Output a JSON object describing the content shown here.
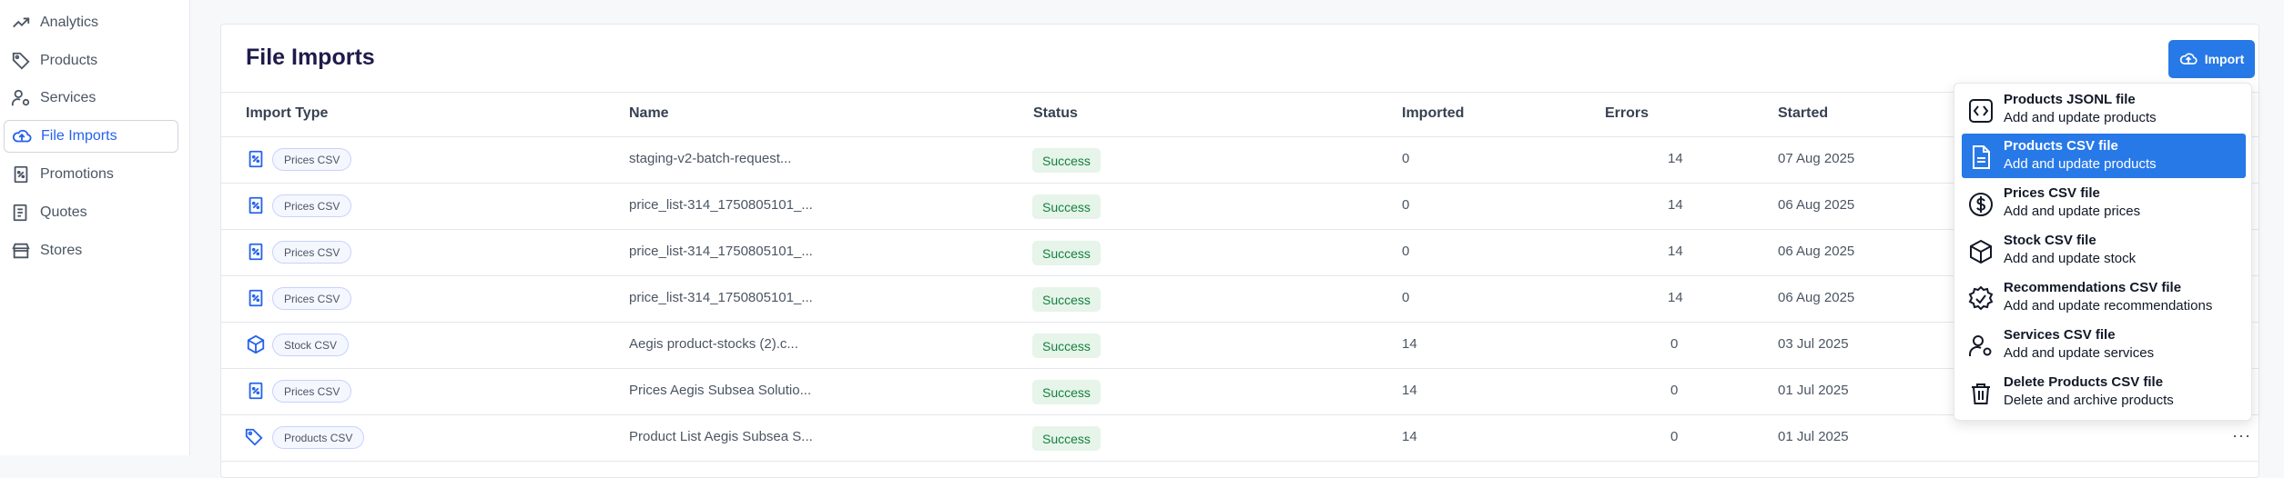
{
  "sidebar": {
    "items": [
      {
        "label": "Analytics",
        "icon": "trending-up-icon"
      },
      {
        "label": "Products",
        "icon": "tag-icon"
      },
      {
        "label": "Services",
        "icon": "user-cog-icon"
      },
      {
        "label": "File Imports",
        "icon": "cloud-upload-icon",
        "active": true
      },
      {
        "label": "Promotions",
        "icon": "percent-receipt-icon"
      },
      {
        "label": "Quotes",
        "icon": "document-list-icon"
      },
      {
        "label": "Stores",
        "icon": "store-icon"
      }
    ]
  },
  "page": {
    "title": "File Imports",
    "import_button_label": "Import"
  },
  "table": {
    "headers": [
      "Import Type",
      "Name",
      "Status",
      "Imported",
      "Errors",
      "Started"
    ],
    "rows": [
      {
        "type": "Prices CSV",
        "type_icon": "percent-receipt-icon",
        "name": "staging-v2-batch-request...",
        "status": "Success",
        "imported": "0",
        "errors": "14",
        "started": "07 Aug 2025"
      },
      {
        "type": "Prices CSV",
        "type_icon": "percent-receipt-icon",
        "name": "price_list-314_1750805101_...",
        "status": "Success",
        "imported": "0",
        "errors": "14",
        "started": "06 Aug 2025"
      },
      {
        "type": "Prices CSV",
        "type_icon": "percent-receipt-icon",
        "name": "price_list-314_1750805101_...",
        "status": "Success",
        "imported": "0",
        "errors": "14",
        "started": "06 Aug 2025"
      },
      {
        "type": "Prices CSV",
        "type_icon": "percent-receipt-icon",
        "name": "price_list-314_1750805101_...",
        "status": "Success",
        "imported": "0",
        "errors": "14",
        "started": "06 Aug 2025"
      },
      {
        "type": "Stock CSV",
        "type_icon": "cube-icon",
        "name": "Aegis product-stocks (2).c...",
        "status": "Success",
        "imported": "14",
        "errors": "0",
        "started": "03 Jul 2025"
      },
      {
        "type": "Prices CSV",
        "type_icon": "percent-receipt-icon",
        "name": "Prices Aegis Subsea Solutio...",
        "status": "Success",
        "imported": "14",
        "errors": "0",
        "started": "01 Jul 2025"
      },
      {
        "type": "Products CSV",
        "type_icon": "tag-icon",
        "name": "Product List Aegis Subsea S...",
        "status": "Success",
        "imported": "14",
        "errors": "0",
        "started": "01 Jul 2025"
      }
    ]
  },
  "dropdown": {
    "items": [
      {
        "title": "Products JSONL file",
        "desc": "Add and update products",
        "icon": "code-icon"
      },
      {
        "title": "Products CSV file",
        "desc": "Add and update products",
        "icon": "file-text-icon",
        "selected": true
      },
      {
        "title": "Prices CSV file",
        "desc": "Add and update prices",
        "icon": "dollar-circle-icon"
      },
      {
        "title": "Stock CSV file",
        "desc": "Add and update stock",
        "icon": "cube-icon"
      },
      {
        "title": "Recommendations CSV file",
        "desc": "Add and update recommendations",
        "icon": "badge-check-icon"
      },
      {
        "title": "Services CSV file",
        "desc": "Add and update services",
        "icon": "user-cog-icon"
      },
      {
        "title": "Delete Products CSV file",
        "desc": "Delete and archive products",
        "icon": "trash-icon"
      }
    ]
  },
  "colors": {
    "accent": "#2779e8",
    "title": "#1e1b4b",
    "success_bg": "#e6f4ea",
    "success_text": "#15803d"
  }
}
